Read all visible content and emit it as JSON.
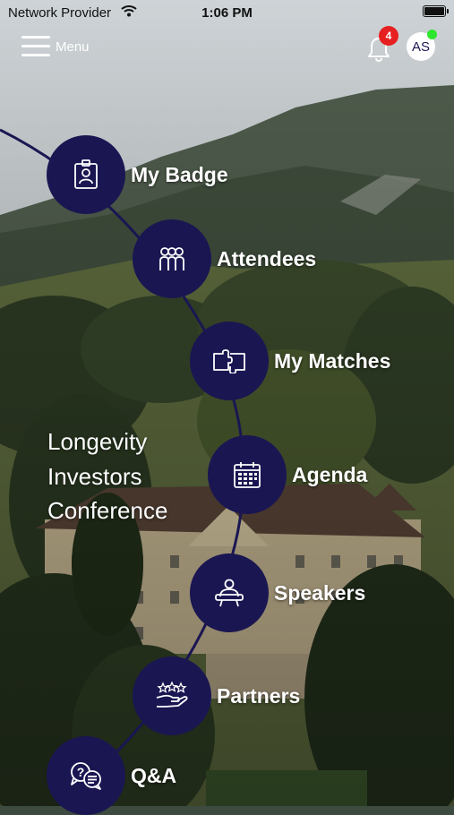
{
  "status_bar": {
    "carrier": "Network Provider",
    "time": "1:06 PM"
  },
  "header": {
    "menu_label": "Menu",
    "notification_count": "4",
    "user_initials": "AS"
  },
  "conference": {
    "line1": "Longevity",
    "line2": "Investors",
    "line3": "Conference"
  },
  "menu_items": [
    {
      "label": "My Badge",
      "icon": "badge-icon"
    },
    {
      "label": "Attendees",
      "icon": "attendees-icon"
    },
    {
      "label": "My Matches",
      "icon": "puzzle-icon"
    },
    {
      "label": "Agenda",
      "icon": "calendar-icon"
    },
    {
      "label": "Speakers",
      "icon": "speaker-icon"
    },
    {
      "label": "Partners",
      "icon": "handshake-stars-icon"
    },
    {
      "label": "Q&A",
      "icon": "chat-bubbles-icon"
    }
  ],
  "colors": {
    "circle": "#1a1652",
    "notification_badge": "#e62020",
    "online_status": "#2ee62e"
  }
}
